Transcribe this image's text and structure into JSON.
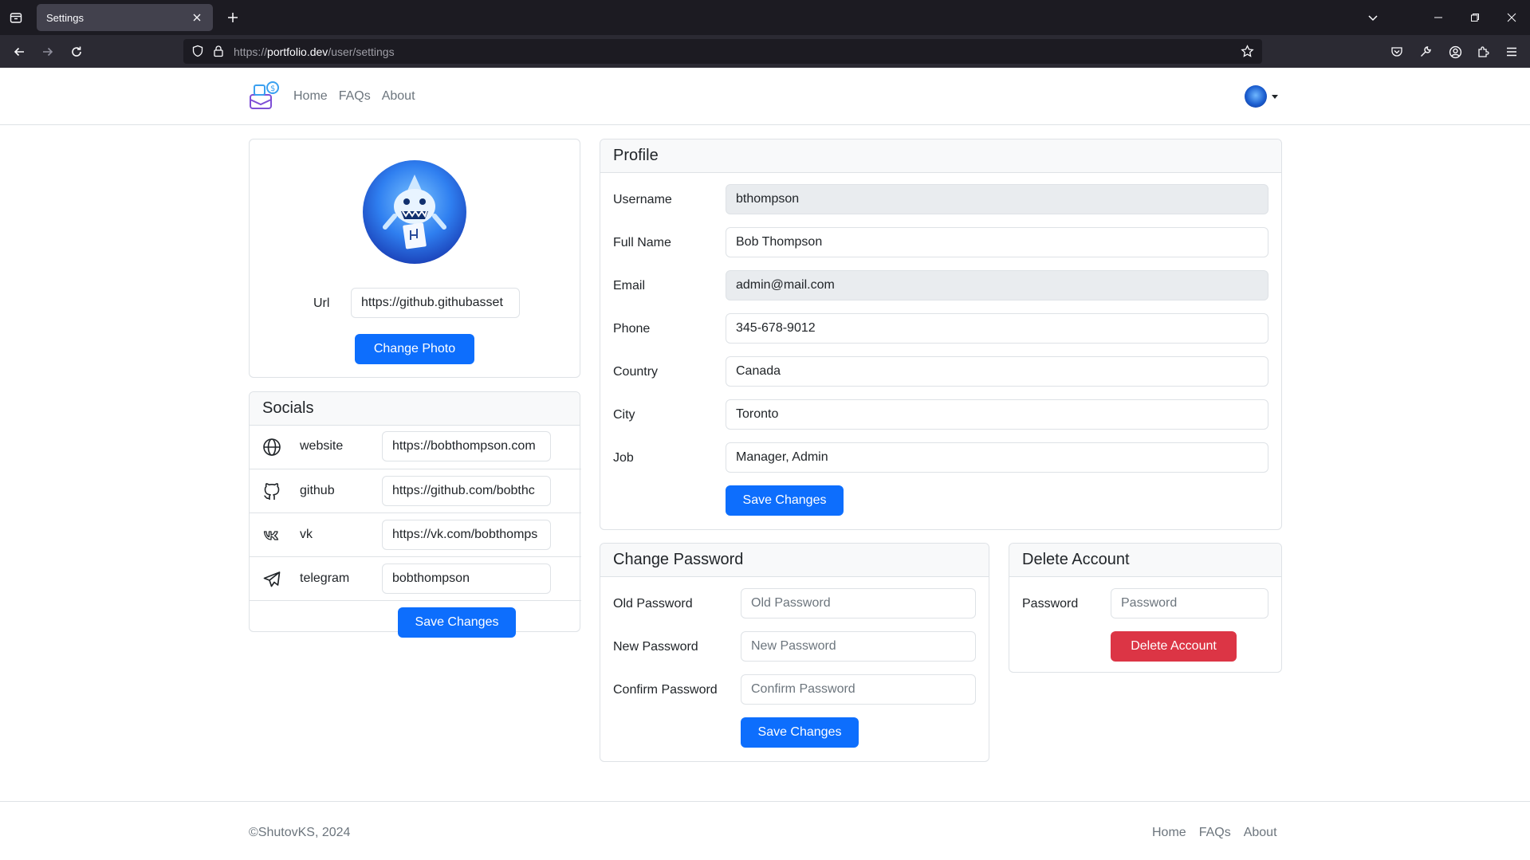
{
  "browser": {
    "tab_title": "Settings",
    "url_prefix": "https://",
    "url_host": "portfolio.dev",
    "url_path": "/user/settings"
  },
  "header": {
    "nav": [
      "Home",
      "FAQs",
      "About"
    ]
  },
  "photo_card": {
    "url_label": "Url",
    "url_value": "https://github.githubasset",
    "change_photo_label": "Change Photo"
  },
  "socials": {
    "title": "Socials",
    "rows": [
      {
        "name": "website",
        "icon": "globe-icon",
        "value": "https://bobthompson.com"
      },
      {
        "name": "github",
        "icon": "github-icon",
        "value": "https://github.com/bobthc"
      },
      {
        "name": "vk",
        "icon": "vk-icon",
        "value": "https://vk.com/bobthomps"
      },
      {
        "name": "telegram",
        "icon": "telegram-icon",
        "value": "bobthompson"
      }
    ],
    "save_label": "Save Changes"
  },
  "profile": {
    "title": "Profile",
    "fields": [
      {
        "label": "Username",
        "value": "bthompson",
        "disabled": true
      },
      {
        "label": "Full Name",
        "value": "Bob Thompson",
        "disabled": false
      },
      {
        "label": "Email",
        "value": "admin@mail.com",
        "disabled": true
      },
      {
        "label": "Phone",
        "value": "345-678-9012",
        "disabled": false
      },
      {
        "label": "Country",
        "value": "Canada",
        "disabled": false
      },
      {
        "label": "City",
        "value": "Toronto",
        "disabled": false
      },
      {
        "label": "Job",
        "value": "Manager, Admin",
        "disabled": false
      }
    ],
    "save_label": "Save Changes"
  },
  "change_password": {
    "title": "Change Password",
    "fields": [
      {
        "label": "Old Password",
        "placeholder": "Old Password"
      },
      {
        "label": "New Password",
        "placeholder": "New Password"
      },
      {
        "label": "Confirm Password",
        "placeholder": "Confirm Password"
      }
    ],
    "save_label": "Save Changes"
  },
  "delete_account": {
    "title": "Delete Account",
    "password_label": "Password",
    "password_placeholder": "Password",
    "delete_label": "Delete Account"
  },
  "footer": {
    "copyright": "©ShutovKS, 2024",
    "nav": [
      "Home",
      "FAQs",
      "About"
    ]
  },
  "colors": {
    "primary": "#0d6efd",
    "danger": "#dc3545",
    "border": "#dee2e6",
    "muted": "#6c757d"
  }
}
